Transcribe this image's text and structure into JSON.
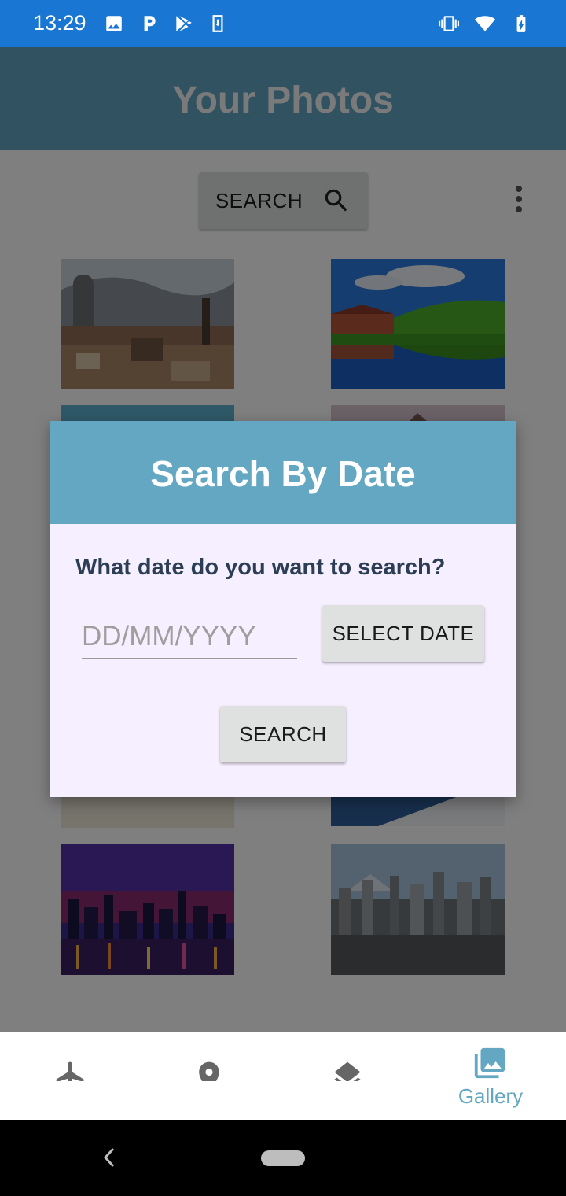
{
  "status_bar": {
    "time": "13:29",
    "left_icons": [
      "image-icon",
      "parking-icon",
      "play-store-icon",
      "download-icon"
    ],
    "right_icons": [
      "vibrate-icon",
      "wifi-icon",
      "battery-charging-icon"
    ]
  },
  "app_bar": {
    "title": "Your Photos"
  },
  "toolbar": {
    "search_label": "SEARCH",
    "overflow_icon": "more-vert-icon"
  },
  "photos": [
    {
      "subject": "city-tower"
    },
    {
      "subject": "lake-house"
    },
    {
      "subject": "beach"
    },
    {
      "subject": "mountain"
    },
    {
      "subject": "sand"
    },
    {
      "subject": "snow-slope"
    },
    {
      "subject": "night-skyline"
    },
    {
      "subject": "tokyo-fuji"
    }
  ],
  "dialog": {
    "title": "Search By Date",
    "question": "What date do you want to search?",
    "date_placeholder": "DD/MM/YYYY",
    "date_value": "",
    "select_date_label": "SELECT DATE",
    "search_label": "SEARCH"
  },
  "bottom_nav": {
    "items": [
      {
        "icon": "airplane-icon",
        "label": ""
      },
      {
        "icon": "place-icon",
        "label": ""
      },
      {
        "icon": "layers-icon",
        "label": ""
      },
      {
        "icon": "gallery-icon",
        "label": "Gallery",
        "selected": true
      }
    ],
    "accent_color": "#63a7c2"
  },
  "colors": {
    "status_bar": "#1976d2",
    "app_bar": "#63a7c2",
    "dialog_bg": "#f6efff",
    "dialog_text": "#2c3e55"
  }
}
